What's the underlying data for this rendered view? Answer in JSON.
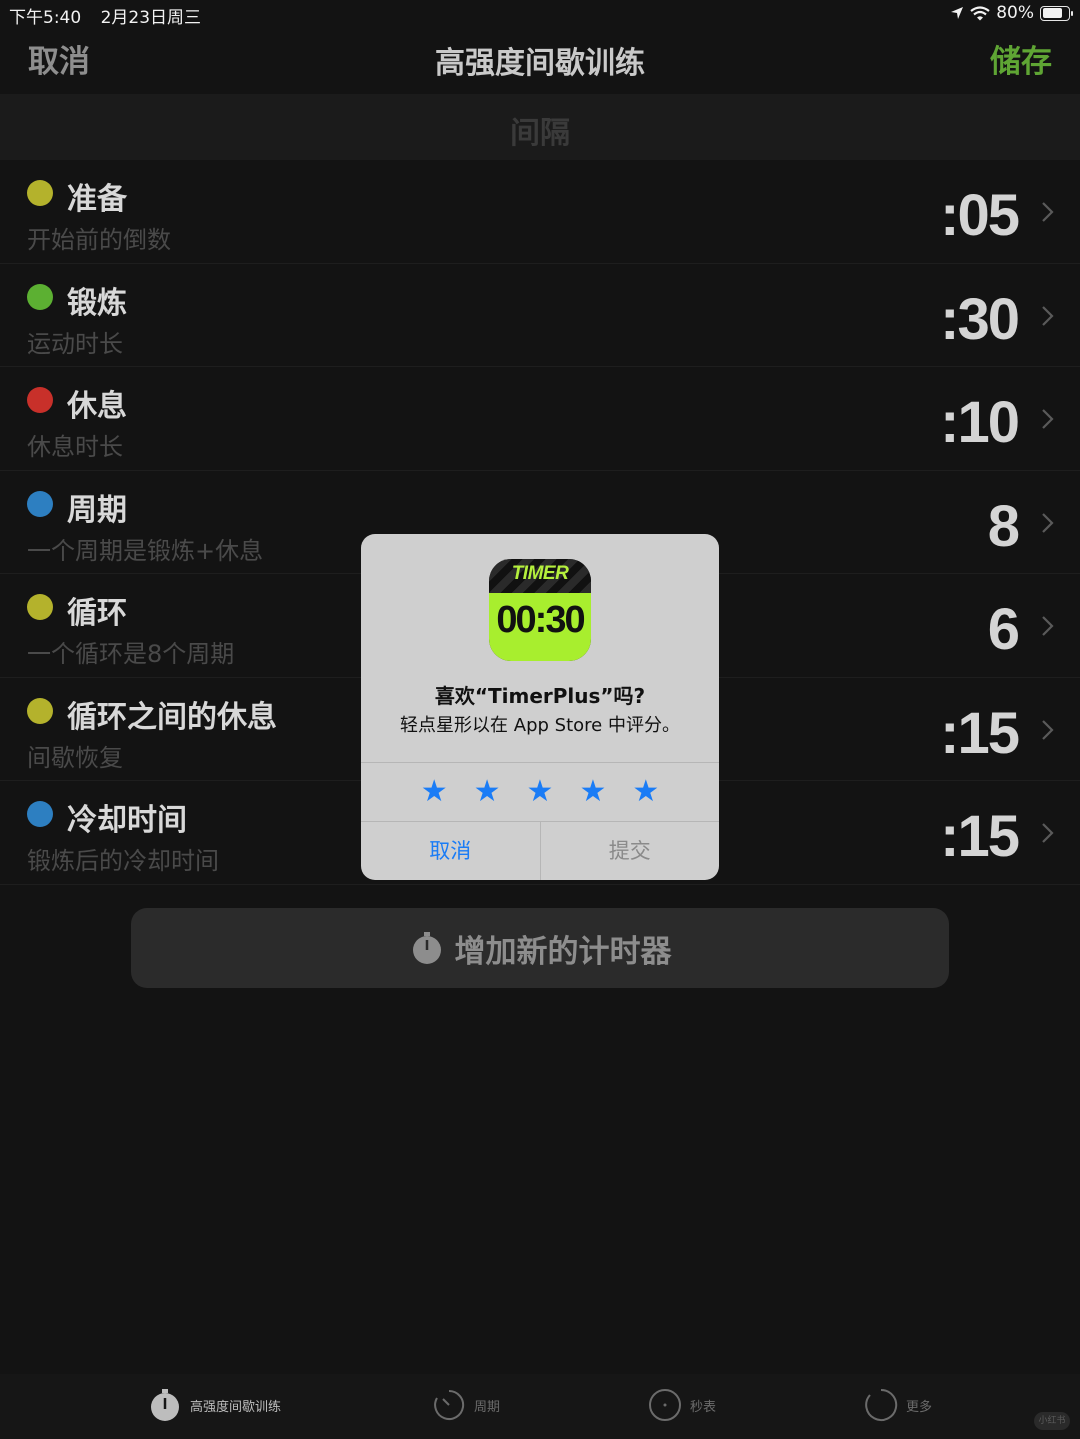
{
  "status_bar": {
    "time": "下午5:40",
    "date": "2月23日周三",
    "battery": "80%",
    "battery_level": 0.8
  },
  "nav": {
    "cancel": "取消",
    "title": "高强度间歇训练",
    "save": "储存"
  },
  "section_header": "间隔",
  "rows": [
    {
      "label": "准备",
      "sub": "开始前的倒数",
      "value": ":05",
      "color": "#b4b22c"
    },
    {
      "label": "锻炼",
      "sub": "运动时长",
      "value": ":30",
      "color": "#5cb032"
    },
    {
      "label": "休息",
      "sub": "休息时长",
      "value": ":10",
      "color": "#c8302a"
    },
    {
      "label": "周期",
      "sub": "一个周期是锻炼+休息",
      "value": "8",
      "color": "#2d7fc1"
    },
    {
      "label": "循环",
      "sub": "一个循环是8个周期",
      "value": "6",
      "color": "#b4b22c"
    },
    {
      "label": "循环之间的休息",
      "sub": "间歇恢复",
      "value": ":15",
      "color": "#b4b22c"
    },
    {
      "label": "冷却时间",
      "sub": "锻炼后的冷却时间",
      "value": ":15",
      "color": "#2d7fc1"
    }
  ],
  "add_timer": "增加新的计时器",
  "tabs": [
    {
      "label": "高强度间歇训练",
      "icon": "stopwatch-icon"
    },
    {
      "label": "周期",
      "icon": "cycle-icon"
    },
    {
      "label": "秒表",
      "icon": "dot-circle-icon"
    },
    {
      "label": "更多",
      "icon": "refresh-circle-icon"
    }
  ],
  "dialog": {
    "app_brand": "TIMER",
    "app_time": "00:30",
    "title": "喜欢“TimerPlus”吗?",
    "message": "轻点星形以在 App Store 中评分。",
    "star_count": 5,
    "cancel": "取消",
    "submit": "提交",
    "accent_color": "#1a7cf6"
  },
  "watermark": "小红书"
}
